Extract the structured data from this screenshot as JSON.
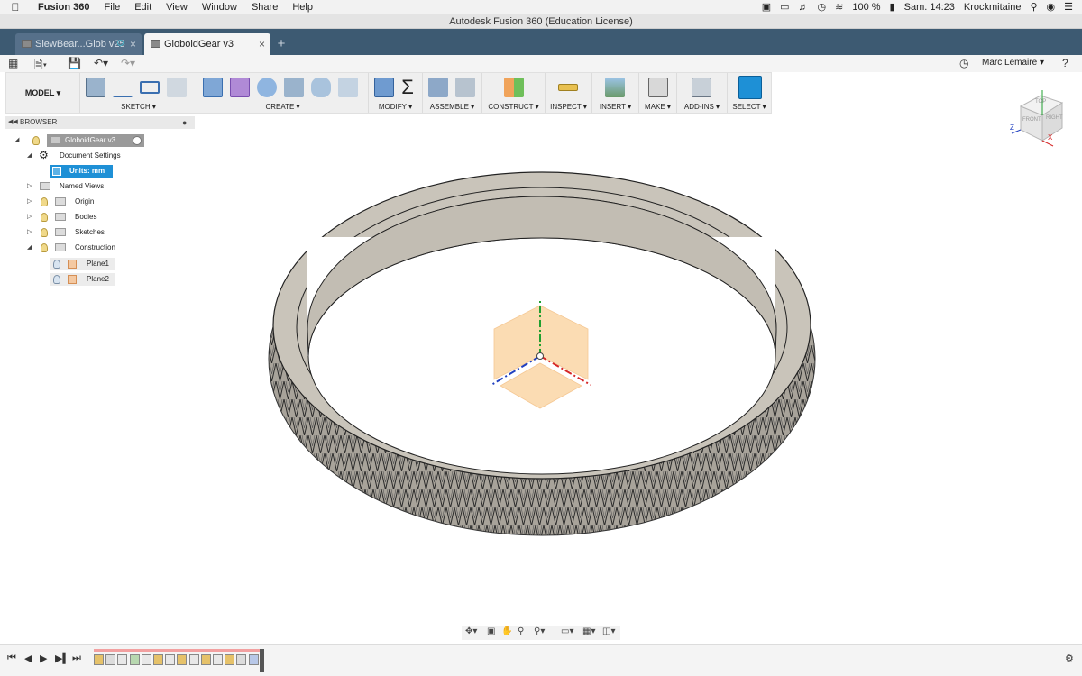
{
  "menubar": {
    "app_name": "Fusion 360",
    "items": [
      "File",
      "Edit",
      "View",
      "Window",
      "Share",
      "Help"
    ],
    "battery": "100 %",
    "clock": "Sam. 14:23",
    "user": "Krockmitaine"
  },
  "window": {
    "title": "Autodesk Fusion 360 (Education License)"
  },
  "tabs": [
    {
      "label": "SlewBear...Glob v25"
    },
    {
      "label": "GloboidGear v3"
    }
  ],
  "account": {
    "name": "Marc Lemaire"
  },
  "toolbar": {
    "workspace": "MODEL",
    "groups": [
      {
        "label": "SKETCH"
      },
      {
        "label": "CREATE"
      },
      {
        "label": "MODIFY"
      },
      {
        "label": "ASSEMBLE"
      },
      {
        "label": "CONSTRUCT"
      },
      {
        "label": "INSPECT"
      },
      {
        "label": "INSERT"
      },
      {
        "label": "MAKE"
      },
      {
        "label": "ADD-INS"
      },
      {
        "label": "SELECT"
      }
    ]
  },
  "browser": {
    "header": "BROWSER",
    "root": "GloboidGear v3",
    "document_settings": "Document Settings",
    "units": "Units: mm",
    "named_views": "Named Views",
    "origin": "Origin",
    "bodies": "Bodies",
    "sketches": "Sketches",
    "construction": "Construction",
    "plane1": "Plane1",
    "plane2": "Plane2"
  },
  "viewcube": {
    "top": "TOP",
    "front": "FRONT",
    "right": "RIGHT",
    "axis_z": "Z",
    "axis_x": "X"
  },
  "colors": {
    "tab_bar": "#3d5a72",
    "selection": "#1e90d6",
    "gear_face": "#c9c4ba",
    "axis_x": "#d62828",
    "axis_y": "#20a030",
    "axis_z": "#2040c0",
    "plane_fill": "#fbdcb3"
  }
}
